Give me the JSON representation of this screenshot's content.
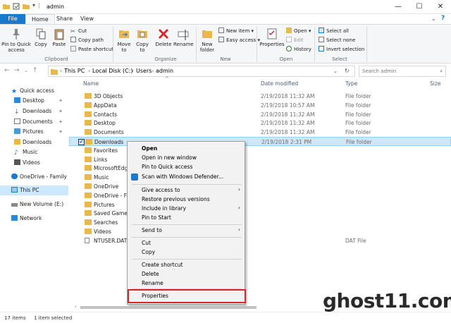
{
  "window": {
    "title": "admin"
  },
  "tabs": [
    "File",
    "Home",
    "Share",
    "View"
  ],
  "ribbon": {
    "clipboard": {
      "pin": "Pin to Quick access",
      "copy": "Copy",
      "paste": "Paste",
      "cut": "Cut",
      "copy_path": "Copy path",
      "paste_shortcut": "Paste shortcut",
      "group": "Clipboard"
    },
    "organize": {
      "move_to": "Move to",
      "copy_to": "Copy to",
      "delete": "Delete",
      "rename": "Rename",
      "group": "Organize"
    },
    "new": {
      "new_folder": "New folder",
      "new_item": "New item",
      "easy_access": "Easy access",
      "group": "New"
    },
    "open": {
      "properties": "Properties",
      "open": "Open",
      "edit": "Edit",
      "history": "History",
      "group": "Open"
    },
    "select": {
      "select_all": "Select all",
      "select_none": "Select none",
      "invert": "Invert selection",
      "group": "Select"
    }
  },
  "address": {
    "crumbs": [
      "This PC",
      "Local Disk (C:)",
      "Users",
      "admin"
    ],
    "search_placeholder": "Search admin"
  },
  "nav": [
    {
      "label": "Quick access",
      "pinned": false
    },
    {
      "label": "Desktop",
      "pinned": true
    },
    {
      "label": "Downloads",
      "pinned": true
    },
    {
      "label": "Documents",
      "pinned": true
    },
    {
      "label": "Pictures",
      "pinned": true
    },
    {
      "label": "Downloads",
      "pinned": false
    },
    {
      "label": "Music",
      "pinned": false
    },
    {
      "label": "Videos",
      "pinned": false
    },
    {
      "label": "OneDrive - Family",
      "pinned": false
    },
    {
      "label": "This PC",
      "pinned": false
    },
    {
      "label": "New Volume (E:)",
      "pinned": false
    },
    {
      "label": "Network",
      "pinned": false
    }
  ],
  "columns": {
    "name": "Name",
    "date": "Date modified",
    "type": "Type",
    "size": "Size"
  },
  "files": [
    {
      "name": "3D Objects",
      "date": "2/19/2018 11:32 AM",
      "type": "File folder"
    },
    {
      "name": "AppData",
      "date": "2/19/2018 10:57 AM",
      "type": "File folder"
    },
    {
      "name": "Contacts",
      "date": "2/19/2018 11:32 AM",
      "type": "File folder"
    },
    {
      "name": "Desktop",
      "date": "2/19/2018 11:32 AM",
      "type": "File folder"
    },
    {
      "name": "Documents",
      "date": "2/19/2018 11:32 AM",
      "type": "File folder"
    },
    {
      "name": "Downloads",
      "date": "2/19/2018 2:31 PM",
      "type": "File folder"
    },
    {
      "name": "Favorites",
      "date": "",
      "type": ""
    },
    {
      "name": "Links",
      "date": "",
      "type": ""
    },
    {
      "name": "MicrosoftEdgeI",
      "date": "",
      "type": ""
    },
    {
      "name": "Music",
      "date": "",
      "type": ""
    },
    {
      "name": "OneDrive",
      "date": "",
      "type": ""
    },
    {
      "name": "OneDrive - Fam",
      "date": "",
      "type": ""
    },
    {
      "name": "Pictures",
      "date": "",
      "type": ""
    },
    {
      "name": "Saved Games",
      "date": "",
      "type": ""
    },
    {
      "name": "Searches",
      "date": "",
      "type": ""
    },
    {
      "name": "Videos",
      "date": "",
      "type": ""
    },
    {
      "name": "NTUSER.DAT",
      "date": "",
      "type": "DAT File"
    }
  ],
  "context_menu": {
    "open": "Open",
    "open_new_window": "Open in new window",
    "pin_quick": "Pin to Quick access",
    "scan": "Scan with Windows Defender...",
    "give_access": "Give access to",
    "restore": "Restore previous versions",
    "include_library": "Include in library",
    "pin_start": "Pin to Start",
    "send_to": "Send to",
    "cut": "Cut",
    "copy": "Copy",
    "create_shortcut": "Create shortcut",
    "delete": "Delete",
    "rename": "Rename",
    "properties": "Properties"
  },
  "status": {
    "items": "17 items",
    "selected": "1 item selected"
  },
  "watermark": "ghost11.com",
  "colors": {
    "accent": "#1979ca",
    "selection": "#cce8ff",
    "highlight_box": "#d8262c",
    "folder": "#e8b84a"
  }
}
